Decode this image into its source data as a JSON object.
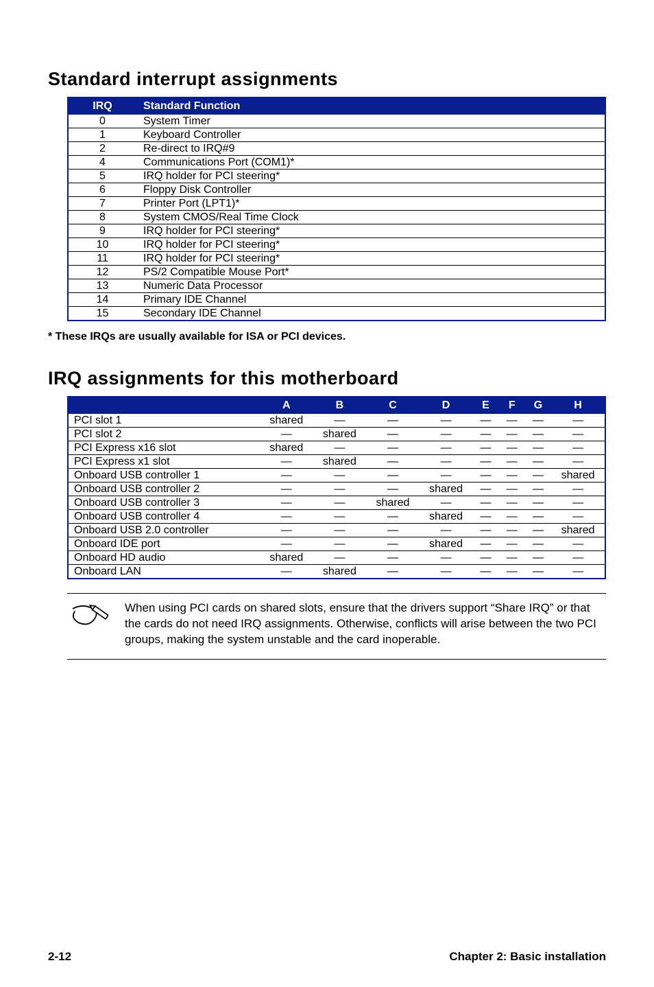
{
  "section1": {
    "title": "Standard interrupt assignments",
    "headers": [
      "IRQ",
      "Standard Function"
    ],
    "rows": [
      [
        "0",
        "System Timer"
      ],
      [
        "1",
        "Keyboard Controller"
      ],
      [
        "2",
        "Re-direct to IRQ#9"
      ],
      [
        "4",
        "Communications Port (COM1)*"
      ],
      [
        "5",
        "IRQ holder for PCI steering*"
      ],
      [
        "6",
        "Floppy Disk Controller"
      ],
      [
        "7",
        "Printer Port (LPT1)*"
      ],
      [
        "8",
        "System CMOS/Real Time Clock"
      ],
      [
        "9",
        "IRQ holder for PCI steering*"
      ],
      [
        "10",
        "IRQ holder for PCI steering*"
      ],
      [
        "11",
        "IRQ holder for PCI steering*"
      ],
      [
        "12",
        "PS/2 Compatible Mouse Port*"
      ],
      [
        "13",
        "Numeric Data Processor"
      ],
      [
        "14",
        "Primary IDE Channel"
      ],
      [
        "15",
        "Secondary IDE Channel"
      ]
    ],
    "footnote": "* These IRQs are usually available for ISA or PCI devices."
  },
  "section2": {
    "title": "IRQ assignments for this motherboard",
    "headers": [
      "",
      "A",
      "B",
      "C",
      "D",
      "E",
      "F",
      "G",
      "H"
    ],
    "rows": [
      [
        "PCI slot 1",
        "shared",
        "—",
        "—",
        "—",
        "—",
        "—",
        "—",
        "—"
      ],
      [
        "PCI slot 2",
        "—",
        "shared",
        "—",
        "—",
        "—",
        "—",
        "—",
        "—"
      ],
      [
        "PCI Express x16 slot",
        "shared",
        "—",
        "—",
        "—",
        "—",
        "—",
        "—",
        "—"
      ],
      [
        "PCI Express x1 slot",
        "—",
        "shared",
        "—",
        "—",
        "—",
        "—",
        "—",
        "—"
      ],
      [
        "Onboard USB controller 1",
        "—",
        "—",
        "—",
        "—",
        "—",
        "—",
        "—",
        "shared"
      ],
      [
        "Onboard USB controller 2",
        "—",
        "—",
        "—",
        "shared",
        "—",
        "—",
        "—",
        "—"
      ],
      [
        "Onboard USB controller 3",
        "—",
        "—",
        "shared",
        "—",
        "—",
        "—",
        "—",
        "—"
      ],
      [
        "Onboard USB controller 4",
        "—",
        "—",
        "—",
        "shared",
        "—",
        "—",
        "—",
        "—"
      ],
      [
        "Onboard USB 2.0 controller",
        "—",
        "—",
        "—",
        "—",
        "—",
        "—",
        "—",
        "shared"
      ],
      [
        "Onboard IDE port",
        "—",
        "—",
        "—",
        "shared",
        "—",
        "—",
        "—",
        "—"
      ],
      [
        "Onboard HD audio",
        "shared",
        "—",
        "—",
        "—",
        "—",
        "—",
        "—",
        "—"
      ],
      [
        "Onboard LAN",
        "—",
        "shared",
        "—",
        "—",
        "—",
        "—",
        "—",
        "—"
      ]
    ]
  },
  "note": "When using PCI cards on shared slots, ensure that the drivers support “Share IRQ” or that the cards do not need IRQ assignments. Otherwise, conflicts will arise between the two PCI groups, making the system unstable and the card inoperable.",
  "footer": {
    "left": "2-12",
    "right": "Chapter 2: Basic installation"
  }
}
